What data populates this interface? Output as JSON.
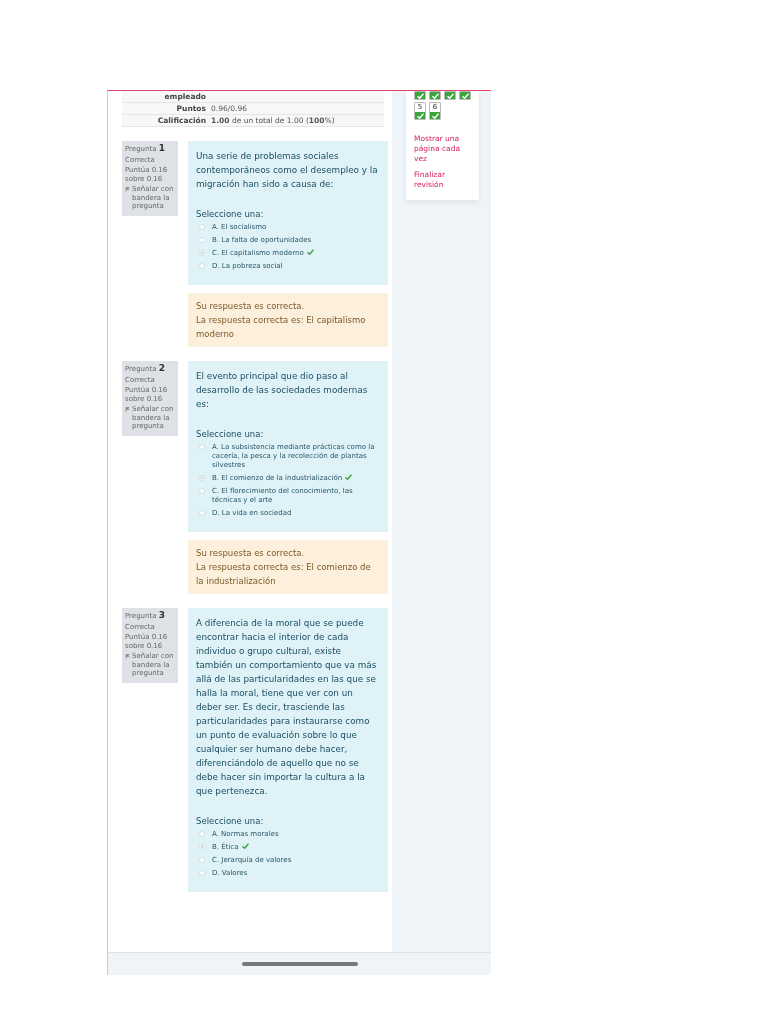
{
  "summary": {
    "rows": [
      {
        "label": "empleado"
      },
      {
        "label": "Puntos",
        "value": "0.96/0.96"
      },
      {
        "label": "Calificación",
        "value": "**1.00** de un total de 1.00 (**100**%)"
      }
    ]
  },
  "nav": {
    "buttons": [
      {
        "correct": true
      },
      {
        "correct": true
      },
      {
        "correct": true
      },
      {
        "correct": true
      },
      {
        "number": "5",
        "correct": true
      },
      {
        "number": "6",
        "correct": true
      }
    ],
    "links": [
      "Mostrar una página cada vez",
      "Finalizar revisión"
    ]
  },
  "questions": [
    {
      "label": "Pregunta",
      "number": "1",
      "status": "Correcta",
      "points": "Puntúa 0.16 sobre 0.16",
      "flag": "Señalar con bandera la pregunta",
      "text": "Una serie de problemas sociales contemporáneos como el desempleo y la migración han sido a causa de:",
      "prompt": "Seleccione una:",
      "options": [
        {
          "label": "A. El socialismo",
          "selected": false,
          "correct": false
        },
        {
          "label": "B. La falta de oportunidades",
          "selected": false,
          "correct": false
        },
        {
          "label": "C. El capitalismo moderno",
          "selected": true,
          "correct": true
        },
        {
          "label": "D. La pobreza social",
          "selected": false,
          "correct": false
        }
      ],
      "feedback": [
        "Su respuesta es correcta.",
        "La respuesta correcta es: El capitalismo moderno"
      ]
    },
    {
      "label": "Pregunta",
      "number": "2",
      "status": "Correcta",
      "points": "Puntúa 0.16 sobre 0.16",
      "flag": "Señalar con bandera la pregunta",
      "text": "El evento principal que dio paso al desarrollo de las sociedades modernas es:",
      "prompt": "Seleccione una:",
      "options": [
        {
          "label": "A. La subsistencia mediante prácticas como la cacería, la pesca y la recolección de plantas silvestres",
          "selected": false,
          "correct": false
        },
        {
          "label": "B. El comienzo de la industrialización",
          "selected": true,
          "correct": true
        },
        {
          "label": "C. El florecimiento del conocimiento, las técnicas y el arte",
          "selected": false,
          "correct": false
        },
        {
          "label": "D. La vida en sociedad",
          "selected": false,
          "correct": false
        }
      ],
      "feedback": [
        "Su respuesta es correcta.",
        "La respuesta correcta es: El comienzo de la industrialización"
      ]
    },
    {
      "label": "Pregunta",
      "number": "3",
      "status": "Correcta",
      "points": "Puntúa 0.16 sobre 0.16",
      "flag": "Señalar con bandera la pregunta",
      "text": "A diferencia de la moral que se puede encontrar hacia el interior de cada individuo o grupo cultural, existe también un comportamiento que va más allá de las particularidades en las que se halla la moral, tiene que ver con un deber ser. Es decir, trasciende las particularidades para instaurarse como un punto de evaluación sobre lo que cualquier ser humano debe hacer, diferenciándolo de aquello que no se debe hacer sin importar la cultura a la que pertenezca.",
      "prompt": "Seleccione una:",
      "options": [
        {
          "label": "A. Normas morales",
          "selected": false,
          "correct": false
        },
        {
          "label": "B. Ética",
          "selected": true,
          "correct": true
        },
        {
          "label": "C. Jerarquía de valores",
          "selected": false,
          "correct": false
        },
        {
          "label": "D. Valores",
          "selected": false,
          "correct": false
        }
      ]
    }
  ]
}
